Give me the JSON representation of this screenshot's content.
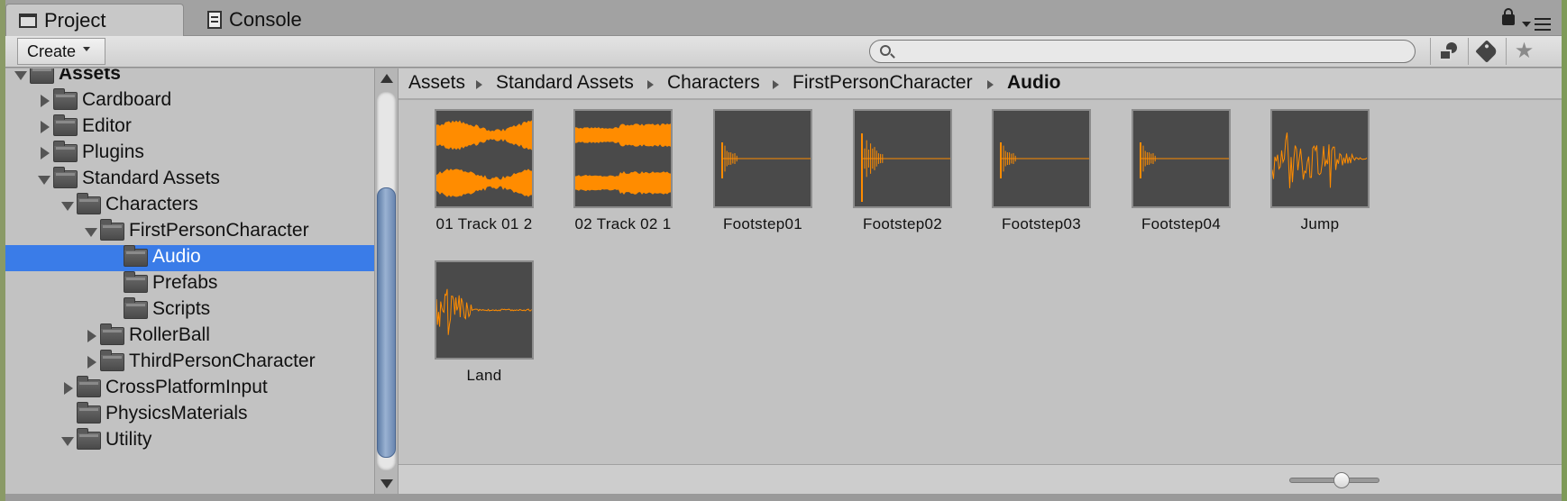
{
  "tabs": [
    {
      "label": "Project",
      "icon": "folder-icon"
    },
    {
      "label": "Console",
      "icon": "console-icon"
    }
  ],
  "toolbar": {
    "create_label": "Create",
    "search_placeholder": ""
  },
  "tree": {
    "items": [
      {
        "label": "Assets",
        "depth": 0,
        "state": "expanded"
      },
      {
        "label": "Cardboard",
        "depth": 1,
        "state": "collapsed"
      },
      {
        "label": "Editor",
        "depth": 1,
        "state": "collapsed"
      },
      {
        "label": "Plugins",
        "depth": 1,
        "state": "collapsed"
      },
      {
        "label": "Standard Assets",
        "depth": 1,
        "state": "expanded"
      },
      {
        "label": "Characters",
        "depth": 2,
        "state": "expanded"
      },
      {
        "label": "FirstPersonCharacter",
        "depth": 3,
        "state": "expanded"
      },
      {
        "label": "Audio",
        "depth": 4,
        "state": "leaf",
        "selected": true
      },
      {
        "label": "Prefabs",
        "depth": 4,
        "state": "leaf"
      },
      {
        "label": "Scripts",
        "depth": 4,
        "state": "leaf"
      },
      {
        "label": "RollerBall",
        "depth": 3,
        "state": "collapsed"
      },
      {
        "label": "ThirdPersonCharacter",
        "depth": 3,
        "state": "collapsed"
      },
      {
        "label": "CrossPlatformInput",
        "depth": 2,
        "state": "collapsed"
      },
      {
        "label": "PhysicsMaterials",
        "depth": 2,
        "state": "leaf"
      },
      {
        "label": "Utility",
        "depth": 2,
        "state": "expanded"
      }
    ]
  },
  "breadcrumb": [
    "Assets",
    "Standard Assets",
    "Characters",
    "FirstPersonCharacter",
    "Audio"
  ],
  "assets": [
    {
      "name": "01 Track 01 2",
      "waveform": "stereo-music-a"
    },
    {
      "name": "02 Track 02 1",
      "waveform": "stereo-music-b"
    },
    {
      "name": "Footstep01",
      "waveform": "footstep"
    },
    {
      "name": "Footstep02",
      "waveform": "footstep-tall"
    },
    {
      "name": "Footstep03",
      "waveform": "footstep"
    },
    {
      "name": "Footstep04",
      "waveform": "footstep"
    },
    {
      "name": "Jump",
      "waveform": "jump"
    },
    {
      "name": "Land",
      "waveform": "land"
    }
  ],
  "colors": {
    "selection": "#3a7ce8",
    "waveform": "#ff8c00",
    "thumb_bg": "#4a4a4a"
  }
}
